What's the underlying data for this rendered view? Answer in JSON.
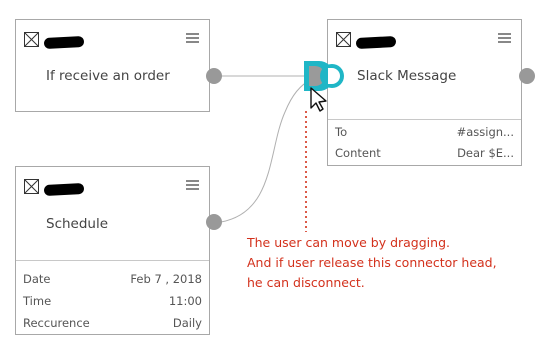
{
  "nodes": {
    "order": {
      "icon": "close-box-icon",
      "title": "If receive an order"
    },
    "slack": {
      "icon": "close-box-icon",
      "title": "Slack Message",
      "props": [
        {
          "key": "To",
          "value": "#assign..."
        },
        {
          "key": "Content",
          "value": "Dear $E..."
        }
      ]
    },
    "schedule": {
      "icon": "close-box-icon",
      "title": "Schedule",
      "props": [
        {
          "key": "Date",
          "value": "Feb 7 , 2018"
        },
        {
          "key": "Time",
          "value": "11:00"
        },
        {
          "key": "Reccurence",
          "value": "Daily"
        }
      ]
    }
  },
  "annotation": {
    "line1": "The user can move by dragging.",
    "line2": "And if user release this connector head,",
    "line3": "he can disconnect."
  },
  "colors": {
    "connector_active": "#1fb6c6",
    "port": "#999999",
    "annotation": "#d3311c"
  },
  "cursor_icon": "mouse-pointer-icon",
  "menu_icon": "hamburger-menu-icon"
}
